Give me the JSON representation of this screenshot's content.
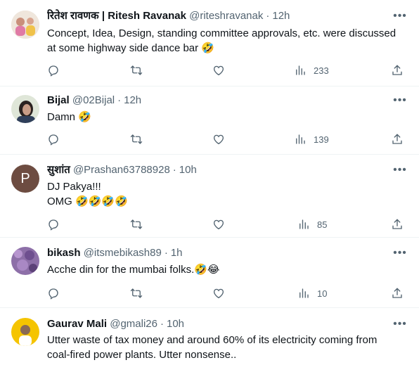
{
  "tweets": [
    {
      "name": "रितेश रावणक | Ritesh Ravanak",
      "handle": "@riteshravanak",
      "time": "12h",
      "text_lines": [
        "Concept, Idea, Design, standing committee approvals, etc. were discussed",
        "at some highway side dance bar 🤣"
      ],
      "views": "233",
      "avatar": "photo"
    },
    {
      "name": "Bijal",
      "handle": "@02Bijal",
      "time": "12h",
      "text_lines": [
        "Damn 🤣"
      ],
      "views": "139",
      "avatar": "photo"
    },
    {
      "name": "सुशांत",
      "handle": "@Prashan63788928",
      "time": "10h",
      "text_lines": [
        "DJ Pakya!!!",
        "OMG 🤣🤣🤣🤣"
      ],
      "views": "85",
      "avatar": "letter",
      "avatar_letter": "P",
      "avatar_color": "#6d4c41"
    },
    {
      "name": "bikash",
      "handle": "@itsmebikash89",
      "time": "1h",
      "text_lines": [
        "Acche din for the mumbai folks.🤣😂"
      ],
      "views": "10",
      "avatar": "photo"
    },
    {
      "name": "Gaurav Mali",
      "handle": "@gmali26",
      "time": "10h",
      "text_lines": [
        "Utter waste of tax money and around 60% of its electricity coming from",
        "coal-fired power plants. Utter nonsense.."
      ],
      "views": "",
      "avatar": "photo"
    }
  ],
  "icons": {
    "reply": "reply-icon",
    "retweet": "retweet-icon",
    "like": "like-icon",
    "views": "views-icon",
    "share": "share-icon",
    "more": "more-icon"
  },
  "colors": {
    "text": "#0f1419",
    "muted": "#536471",
    "divider": "#eff3f4"
  }
}
